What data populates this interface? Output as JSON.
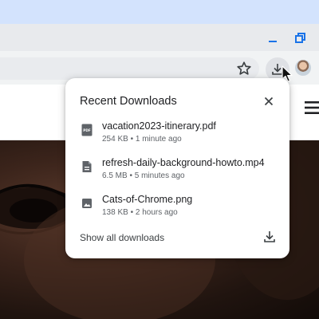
{
  "window": {
    "minimize_icon": "minimize-icon",
    "restore_icon": "restore-icon"
  },
  "toolbar": {
    "bookmark_icon": "star-outline-icon",
    "download_icon": "download-icon",
    "profile_icon": "avatar"
  },
  "page": {
    "menu_icon": "hamburger-menu-icon"
  },
  "downloads": {
    "title": "Recent Downloads",
    "close_icon": "close-icon",
    "items": [
      {
        "name": "vacation2023-itinerary.pdf",
        "size": "254 KB",
        "time": "1 minute ago",
        "icon": "pdf-file-icon"
      },
      {
        "name": "refresh-daily-background-howto.mp4",
        "size": "6.5 MB",
        "time": "5 minutes ago",
        "icon": "document-file-icon"
      },
      {
        "name": "Cats-of-Chrome.png",
        "size": "138 KB",
        "time": "2 hours ago",
        "icon": "image-file-icon"
      }
    ],
    "show_all_label": "Show all downloads",
    "show_all_icon": "download-icon"
  },
  "colors": {
    "accent": "#1a73e8",
    "text_primary": "#202124",
    "text_secondary": "#5f6368"
  }
}
